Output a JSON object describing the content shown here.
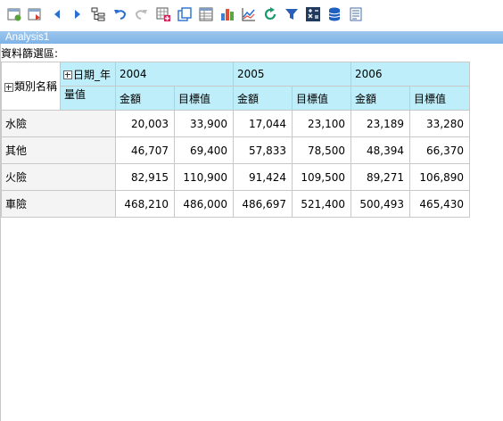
{
  "toolbar": {
    "icons": [
      "new-report-icon",
      "save-report-icon",
      "back-icon",
      "forward-icon",
      "tree-layout-icon",
      "undo-icon",
      "redo-icon",
      "add-calc-icon",
      "copy-icon",
      "table-view-icon",
      "chart-view-icon",
      "line-chart-icon",
      "refresh-icon",
      "filter-icon",
      "formula-icon",
      "database-icon",
      "report-icon"
    ]
  },
  "window": {
    "title": "Analysis1"
  },
  "filter_area": {
    "label": "資料篩選區:"
  },
  "pivot": {
    "column_dimension": "日期_年",
    "row_dimension": "類別名稱",
    "measure_header": "量值",
    "years": [
      "2004",
      "2005",
      "2006"
    ],
    "measures": [
      "金額",
      "目標值"
    ],
    "rows": [
      {
        "name": "水險",
        "values": [
          "20,003",
          "33,900",
          "17,044",
          "23,100",
          "23,189",
          "33,280"
        ]
      },
      {
        "name": "其他",
        "values": [
          "46,707",
          "69,400",
          "57,833",
          "78,500",
          "48,394",
          "66,370"
        ]
      },
      {
        "name": "火險",
        "values": [
          "82,915",
          "110,900",
          "91,424",
          "109,500",
          "89,271",
          "106,890"
        ]
      },
      {
        "name": "車險",
        "values": [
          "468,210",
          "486,000",
          "486,697",
          "521,400",
          "500,493",
          "465,430"
        ]
      }
    ]
  }
}
